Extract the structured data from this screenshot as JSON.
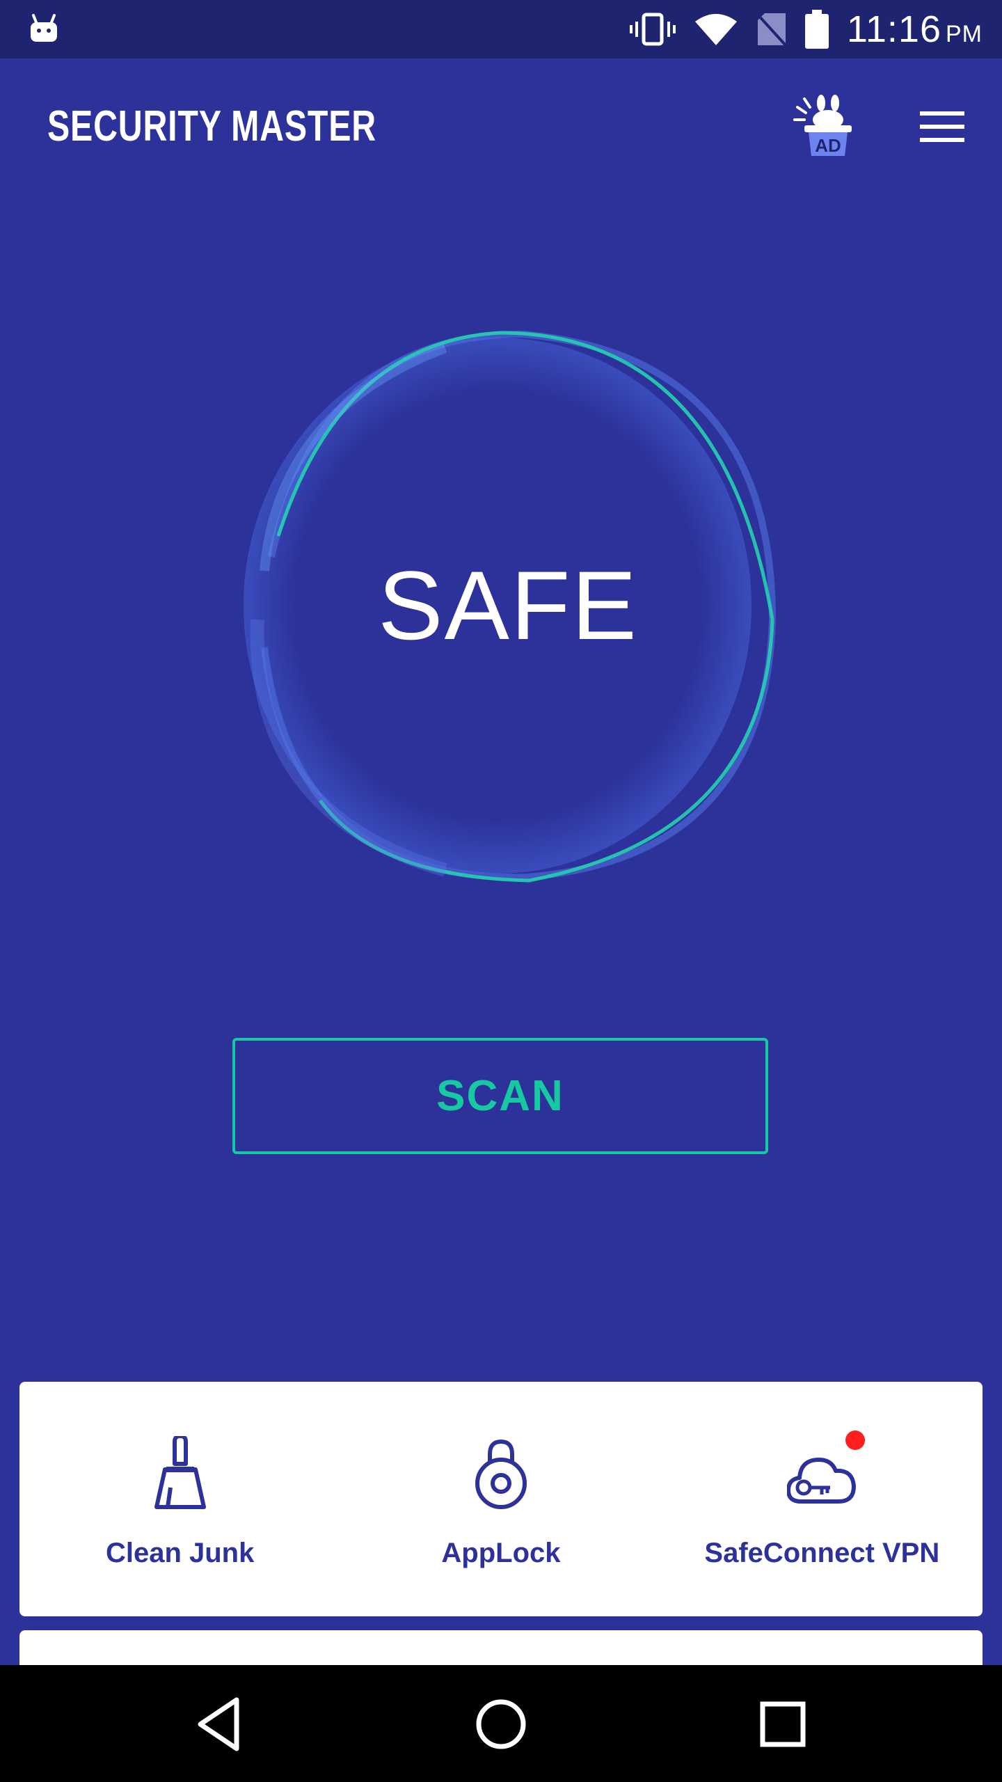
{
  "status_bar": {
    "time": "11:16",
    "ampm": "PM",
    "icons": [
      "android-icon",
      "vibrate-icon",
      "wifi-icon",
      "no-sim-icon",
      "battery-icon"
    ]
  },
  "app_bar": {
    "title": "SECURITY MASTER",
    "ad_label": "AD",
    "menu_icon": "hamburger-menu-icon"
  },
  "status": {
    "label": "SAFE"
  },
  "scan_button": {
    "label": "SCAN"
  },
  "tools": [
    {
      "label": "Clean Junk",
      "icon": "broom-icon"
    },
    {
      "label": "AppLock",
      "icon": "lock-icon"
    },
    {
      "label": "SafeConnect VPN",
      "icon": "cloud-key-icon",
      "badge": true
    }
  ],
  "colors": {
    "background": "#2d329b",
    "status_bar": "#1e2470",
    "accent": "#16c9a2",
    "card": "#ffffff",
    "badge": "#ff1f1f"
  },
  "nav_bar": {
    "buttons": [
      "back-icon",
      "home-icon",
      "recents-icon"
    ]
  }
}
